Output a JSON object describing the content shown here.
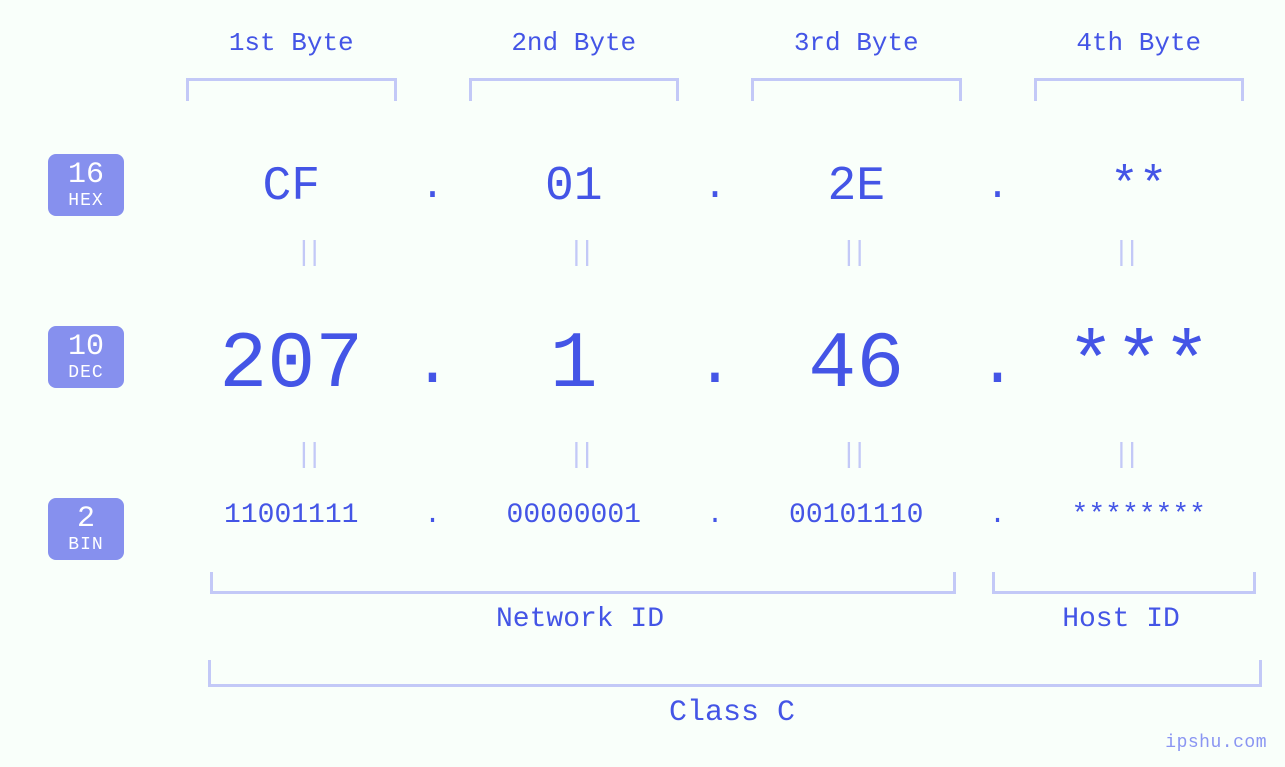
{
  "byte_labels": [
    "1st Byte",
    "2nd Byte",
    "3rd Byte",
    "4th Byte"
  ],
  "radix": {
    "hex": {
      "base": "16",
      "name": "HEX"
    },
    "dec": {
      "base": "10",
      "name": "DEC"
    },
    "bin": {
      "base": "2",
      "name": "BIN"
    }
  },
  "hex": {
    "b1": "CF",
    "b2": "01",
    "b3": "2E",
    "b4": "**"
  },
  "dec": {
    "b1": "207",
    "b2": "1",
    "b3": "46",
    "b4": "***"
  },
  "bin": {
    "b1": "11001111",
    "b2": "00000001",
    "b3": "00101110",
    "b4": "********"
  },
  "dot": ".",
  "eq": "||",
  "groups": {
    "network": "Network ID",
    "host": "Host ID"
  },
  "class_label": "Class C",
  "watermark": "ipshu.com"
}
